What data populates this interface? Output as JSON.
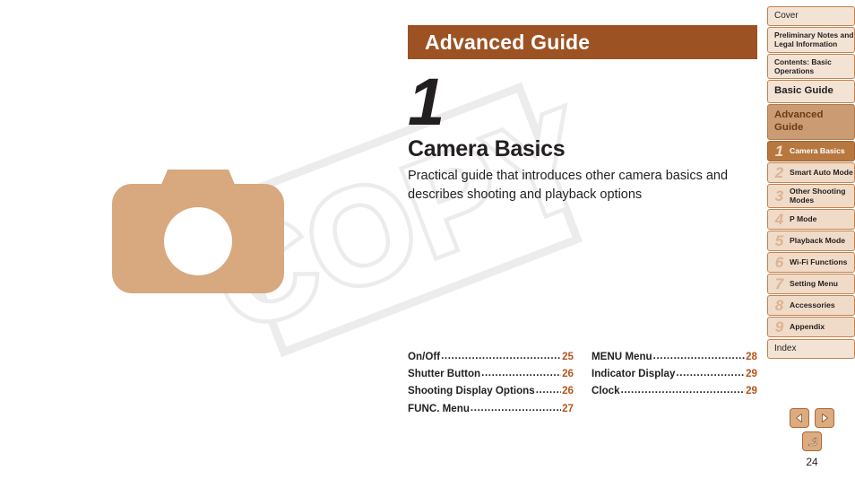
{
  "document": {
    "page_number": "24"
  },
  "header": {
    "bar_label": "Advanced Guide",
    "bar_color": "#9c5222"
  },
  "chapter": {
    "number": "1",
    "title": "Camera Basics",
    "description": "Practical guide that introduces other camera basics and describes shooting and playback options"
  },
  "watermark": {
    "text": "COPY"
  },
  "illustration": {
    "name": "camera-illustration",
    "color": "#d8a87e"
  },
  "toc": {
    "columns": [
      {
        "entries": [
          {
            "label": "On/Off",
            "page": "25"
          },
          {
            "label": "Shutter Button",
            "page": "26"
          },
          {
            "label": "Shooting Display Options",
            "page": "26"
          },
          {
            "label": "FUNC. Menu",
            "page": "27"
          }
        ]
      },
      {
        "entries": [
          {
            "label": "MENU Menu",
            "page": "28"
          },
          {
            "label": "Indicator Display",
            "page": "29"
          },
          {
            "label": "Clock",
            "page": "29"
          }
        ]
      }
    ],
    "page_number_color": "#b4561c"
  },
  "sidebar": {
    "top_items": [
      {
        "label": "Cover",
        "style": "cover"
      },
      {
        "label": "Preliminary Notes and Legal Information",
        "style": "two-line"
      },
      {
        "label": "Contents: Basic Operations",
        "style": "two-line"
      },
      {
        "label": "Basic Guide",
        "style": "basic-guide"
      },
      {
        "label": "Advanced Guide",
        "style": "advanced-guide"
      }
    ],
    "chapters": [
      {
        "number": "1",
        "label": "Camera Basics",
        "selected": true
      },
      {
        "number": "2",
        "label": "Smart Auto Mode",
        "selected": false
      },
      {
        "number": "3",
        "label": "Other Shooting Modes",
        "selected": false
      },
      {
        "number": "4",
        "label": "P Mode",
        "selected": false
      },
      {
        "number": "5",
        "label": "Playback Mode",
        "selected": false
      },
      {
        "number": "6",
        "label": "Wi-Fi Functions",
        "selected": false
      },
      {
        "number": "7",
        "label": "Setting Menu",
        "selected": false
      },
      {
        "number": "8",
        "label": "Accessories",
        "selected": false
      },
      {
        "number": "9",
        "label": "Appendix",
        "selected": false
      }
    ],
    "bottom_items": [
      {
        "label": "Index",
        "style": "index-item"
      }
    ],
    "selected_color": "#b7773f",
    "item_color": "#f0dbc8",
    "border_color": "#c2814e"
  },
  "nav": {
    "previous_label": "Previous page",
    "next_label": "Next page",
    "back_label": "Return"
  }
}
